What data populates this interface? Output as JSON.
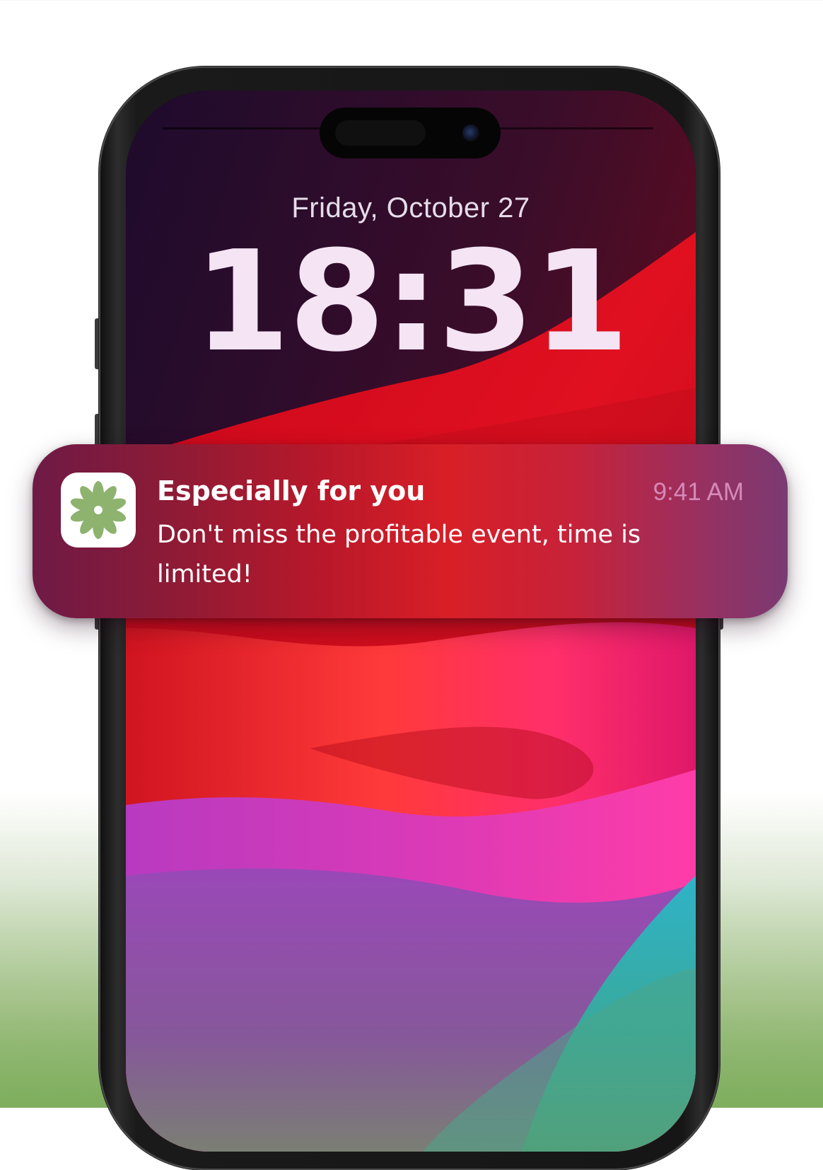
{
  "lock_screen": {
    "date": "Friday, October 27",
    "time": "18:31"
  },
  "notification": {
    "app_icon": "green-flower-logo-icon",
    "title": "Especially for you",
    "time": "9:41 AM",
    "body": "Don't miss the profitable event, time is limited!"
  },
  "colors": {
    "page_background": "#ffffff",
    "page_bottom_green": "#7fae5e",
    "notification_time": "#d58ab8",
    "logo_green": "#8db36f"
  }
}
